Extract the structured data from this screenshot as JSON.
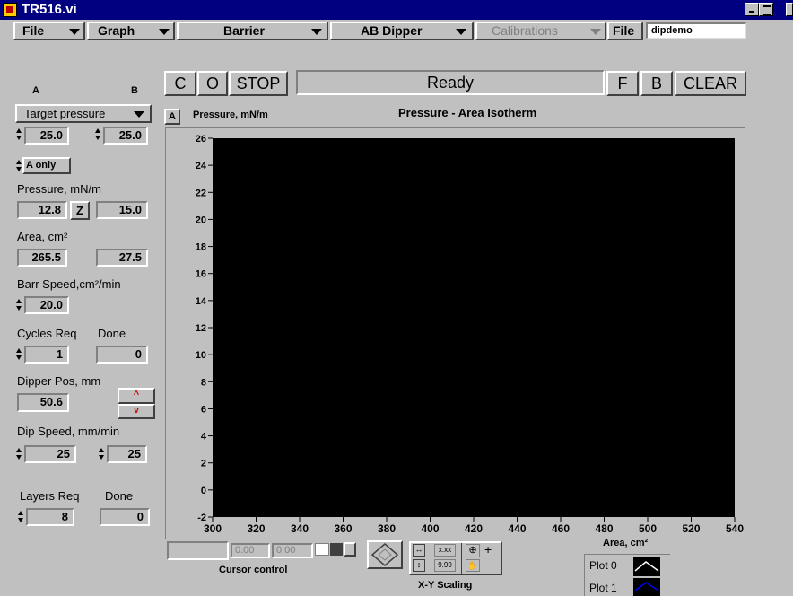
{
  "window": {
    "title": "TR516.vi"
  },
  "menus": {
    "file": "File",
    "graph": "Graph",
    "barrier": "Barrier",
    "ab_dipper": "AB Dipper",
    "calibrations": "Calibrations",
    "file2": "File",
    "file_name": "dipdemo"
  },
  "buttons": {
    "c": "C",
    "o": "O",
    "stop": "STOP",
    "f": "F",
    "b": "B",
    "clear": "CLEAR"
  },
  "status": "Ready",
  "left_panel": {
    "col_a": "A",
    "col_b": "B",
    "target_select": "Target pressure",
    "target_a": "25.0",
    "target_b": "25.0",
    "mode_select": "A only",
    "pressure_label": "Pressure, mN/m",
    "pressure_a": "12.8",
    "zero_button": "Z",
    "pressure_b": "15.0",
    "area_label": "Area, cm²",
    "area_a": "265.5",
    "area_b": "27.5",
    "barr_speed_label": "Barr Speed,cm²/min",
    "barr_speed": "20.0",
    "cycles_req_label": "Cycles Req",
    "cycles_done_label": "Done",
    "cycles_req": "1",
    "cycles_done": "0",
    "dipper_pos_label": "Dipper Pos, mm",
    "dipper_pos": "50.6",
    "dip_speed_label": "Dip Speed, mm/min",
    "dip_speed_a": "25",
    "dip_speed_b": "25",
    "layers_req_label": "Layers Req",
    "layers_done_label": "Done",
    "layers_req": "8",
    "layers_done": "0"
  },
  "graph": {
    "a_indicator": "A",
    "cursor_x": "0.00",
    "cursor_y": "0.00",
    "cursor_control_label": "Cursor control",
    "x_format": "x.xx",
    "y_format": "9.99",
    "xy_scaling_label": "X-Y Scaling",
    "legend": [
      "Plot 0",
      "Plot 1"
    ],
    "legend_colors": [
      "#ffffff",
      "#0000ff"
    ],
    "plot_background": "#000000"
  },
  "chart_data": {
    "type": "line",
    "title": "Pressure - Area Isotherm",
    "xlabel": "Area, cm²",
    "ylabel": "Pressure, mN/m",
    "xlim": [
      300,
      540
    ],
    "ylim": [
      -2,
      26
    ],
    "x_ticks": [
      "300",
      "320",
      "340",
      "360",
      "380",
      "400",
      "420",
      "440",
      "460",
      "480",
      "500",
      "520",
      "540"
    ],
    "y_ticks": [
      "26",
      "24",
      "22",
      "20",
      "18",
      "16",
      "14",
      "12",
      "10",
      "8",
      "6",
      "4",
      "2",
      "0",
      "-2"
    ],
    "series": []
  }
}
